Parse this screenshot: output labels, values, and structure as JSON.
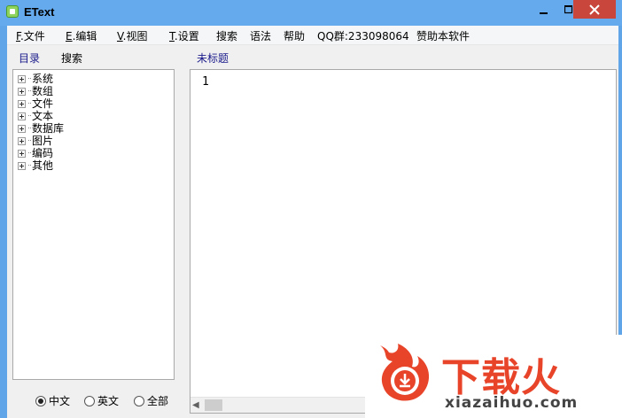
{
  "window": {
    "title": "EText"
  },
  "menu": [
    {
      "prefix": "F",
      "label": ".文件"
    },
    {
      "prefix": "E",
      "label": ".编辑"
    },
    {
      "prefix": "V",
      "label": ".视图"
    },
    {
      "prefix": "T",
      "label": ".设置"
    },
    {
      "prefix": "",
      "label": "搜索"
    },
    {
      "prefix": "",
      "label": "语法"
    },
    {
      "prefix": "",
      "label": "帮助"
    },
    {
      "prefix": "",
      "label": "QQ群:233098064"
    },
    {
      "prefix": "",
      "label": "赞助本软件"
    }
  ],
  "left_tabs": {
    "catalog": "目录",
    "search": "搜索"
  },
  "editor_tab": "未标题",
  "tree": [
    "系统",
    "数组",
    "文件",
    "文本",
    "数据库",
    "图片",
    "编码",
    "其他"
  ],
  "radios": [
    {
      "label": "中文",
      "checked": true
    },
    {
      "label": "英文",
      "checked": false
    },
    {
      "label": "全部",
      "checked": false
    }
  ],
  "editor": {
    "line_number": "1"
  },
  "watermark": {
    "main": "下载火",
    "sub": "xiazaihuo.com"
  },
  "colors": {
    "titlebar": "#64aaed",
    "close": "#c9463d",
    "link": "#1a1a8c",
    "watermark": "#e8442a"
  }
}
